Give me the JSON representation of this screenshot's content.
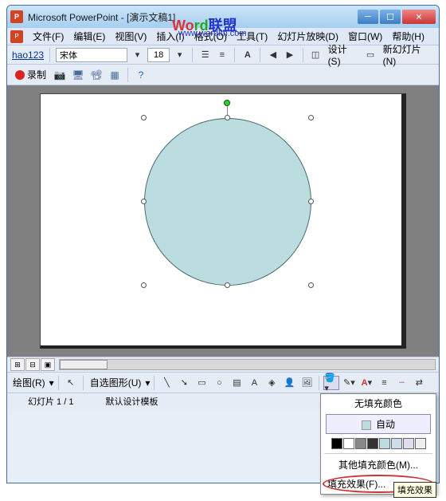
{
  "titlebar": {
    "app": "Microsoft PowerPoint",
    "doc": "[演示文稿1]"
  },
  "menus": {
    "file": "文件(F)",
    "edit": "编辑(E)",
    "view": "视图(V)",
    "insert": "插入(I)",
    "format": "格式(O)",
    "tools": "工具(T)",
    "slideshow": "幻灯片放映(D)",
    "window": "窗口(W)",
    "help": "帮助(H)"
  },
  "toolbar1": {
    "hao": "hao123",
    "font": "宋体",
    "size": "18",
    "design": "设计(S)",
    "newslide": "新幻灯片(N)"
  },
  "toolbar2": {
    "record": "录制"
  },
  "drawbar": {
    "draw": "绘图(R)",
    "autoshapes": "自选图形(U)"
  },
  "status": {
    "slide": "幻灯片 1 / 1",
    "template": "默认设计模板"
  },
  "popup": {
    "nofill": "无填充颜色",
    "auto": "自动",
    "more": "其他填充颜色(M)...",
    "effects": "填充效果(F)...",
    "swatches": [
      "#000000",
      "#ffffff",
      "#888888",
      "#333333",
      "#bcdde0",
      "#cde",
      "#dde",
      "#eee"
    ]
  },
  "tooltip": "填充效果",
  "watermark": {
    "a": "Wo",
    "b": "rd",
    "c": "联盟",
    "url": "www.wordlm.com"
  }
}
